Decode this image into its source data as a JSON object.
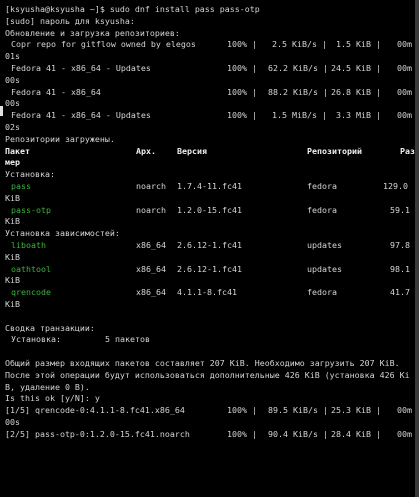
{
  "lines": [
    [
      [
        5,
        "[ksyusha@ksyusha ~]$ sudo dnf install pass pass-otp"
      ]
    ],
    [
      [
        5,
        "[sudo] пароль для ksyusha:"
      ]
    ],
    [
      [
        5,
        "Обновление и загрузка репозиториев:"
      ]
    ],
    [
      [
        11,
        "Copr repo for gitflow owned by elegos"
      ],
      [
        227,
        "100% |"
      ],
      [
        272,
        "2.5 KiB/s |"
      ],
      [
        336,
        "1.5 KiB |"
      ],
      [
        397,
        "00m"
      ]
    ],
    [
      [
        5,
        "01s"
      ]
    ],
    [
      [
        11,
        "Fedora 41 - x86_64 - Updates"
      ],
      [
        227,
        "100% |"
      ],
      [
        268,
        "62.2 KiB/s |"
      ],
      [
        331,
        "24.5 KiB |"
      ],
      [
        397,
        "00m"
      ]
    ],
    [
      [
        5,
        "00s"
      ]
    ],
    [
      [
        11,
        "Fedora 41 - x86_64"
      ],
      [
        227,
        "100% |"
      ],
      [
        268,
        "88.2 KiB/s |"
      ],
      [
        331,
        "26.8 KiB |"
      ],
      [
        397,
        "00m"
      ]
    ],
    [
      [
        5,
        "00s"
      ]
    ],
    [
      [
        11,
        "Fedora 41 - x86_64 - Updates"
      ],
      [
        227,
        "100% |"
      ],
      [
        272,
        "1.5 MiB/s |"
      ],
      [
        336,
        "3.3 MiB |"
      ],
      [
        397,
        "00m"
      ]
    ],
    [
      [
        5,
        "02s"
      ]
    ],
    [
      [
        5,
        "Репозитории загружены."
      ]
    ],
    [
      [
        5,
        "Пакет",
        "b"
      ],
      [
        136,
        "Арх.",
        "b"
      ],
      [
        177,
        "Версия",
        "b"
      ],
      [
        307,
        "Репозиторий",
        "b"
      ],
      [
        400,
        "Раз",
        "b"
      ]
    ],
    [
      [
        5,
        "мер",
        "b"
      ]
    ],
    [
      [
        5,
        "Установка:"
      ]
    ],
    [
      [
        11,
        "pass",
        "g"
      ],
      [
        136,
        "noarch"
      ],
      [
        177,
        "1.7.4-11.fc41"
      ],
      [
        307,
        "fedora"
      ],
      [
        383,
        "129.0"
      ]
    ],
    [
      [
        5,
        "KiB"
      ]
    ],
    [
      [
        11,
        "pass-otp",
        "g"
      ],
      [
        136,
        "noarch"
      ],
      [
        177,
        "1.2.0-15.fc41"
      ],
      [
        307,
        "fedora"
      ],
      [
        390,
        "59.1"
      ]
    ],
    [
      [
        5,
        "KiB"
      ]
    ],
    [
      [
        5,
        "Установка зависимостей:"
      ]
    ],
    [
      [
        11,
        "liboath",
        "g"
      ],
      [
        136,
        "x86_64"
      ],
      [
        177,
        "2.6.12-1.fc41"
      ],
      [
        307,
        "updates"
      ],
      [
        390,
        "97.8"
      ]
    ],
    [
      [
        5,
        "KiB"
      ]
    ],
    [
      [
        11,
        "oathtool",
        "g"
      ],
      [
        136,
        "x86_64"
      ],
      [
        177,
        "2.6.12-1.fc41"
      ],
      [
        307,
        "updates"
      ],
      [
        390,
        "98.1"
      ]
    ],
    [
      [
        5,
        "KiB"
      ]
    ],
    [
      [
        11,
        "qrencode",
        "g"
      ],
      [
        136,
        "x86_64"
      ],
      [
        177,
        "4.1.1-8.fc41"
      ],
      [
        307,
        "fedora"
      ],
      [
        390,
        "41.7"
      ]
    ],
    [
      [
        5,
        "KiB"
      ]
    ],
    [
      [
        5,
        ""
      ]
    ],
    [
      [
        5,
        "Сводка транзакции:"
      ]
    ],
    [
      [
        11,
        "Установка:"
      ],
      [
        105,
        "5 пакетов"
      ]
    ],
    [
      [
        5,
        ""
      ]
    ],
    [
      [
        5,
        "Общий размер входящих пакетов составляет 207 KiB. Необходимо загрузить 207 KiB."
      ]
    ],
    [
      [
        5,
        "После этой операции будут использоваться дополнительные 426 KiB (установка 426 Ki"
      ]
    ],
    [
      [
        5,
        "B, удаление 0 B)."
      ]
    ],
    [
      [
        5,
        "Is this ok [y/N]: y"
      ]
    ],
    [
      [
        5,
        "[1/5] qrencode-0:4.1.1-8.fc41.x86_64"
      ],
      [
        227,
        "100% |"
      ],
      [
        268,
        "89.5 KiB/s |"
      ],
      [
        331,
        "25.3 KiB |"
      ],
      [
        397,
        "00m"
      ]
    ],
    [
      [
        5,
        "00s"
      ]
    ],
    [
      [
        5,
        "[2/5] pass-otp-0:1.2.0-15.fc41.noarch"
      ],
      [
        227,
        "100% |"
      ],
      [
        268,
        "90.4 KiB/s |"
      ],
      [
        331,
        "28.4 KiB |"
      ],
      [
        397,
        "00m"
      ]
    ]
  ]
}
